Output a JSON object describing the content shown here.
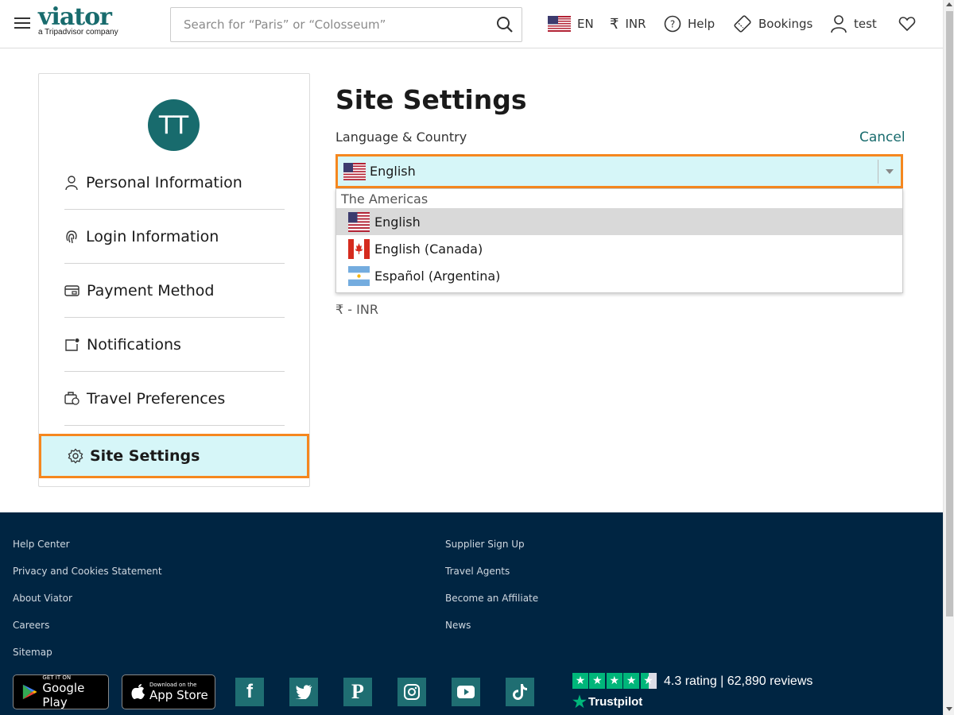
{
  "header": {
    "brand": "viator",
    "brand_sub": "a Tripadvisor company",
    "search_placeholder": "Search for “Paris” or “Colosseum”",
    "lang_label": "EN",
    "currency_label": "INR",
    "help_label": "Help",
    "bookings_label": "Bookings",
    "user_label": "test"
  },
  "sidebar": {
    "avatar_initials": "TT",
    "items": [
      {
        "label": "Personal Information",
        "icon": "person-icon"
      },
      {
        "label": "Login Information",
        "icon": "fingerprint-icon"
      },
      {
        "label": "Payment Method",
        "icon": "card-icon"
      },
      {
        "label": "Notifications",
        "icon": "notification-icon"
      },
      {
        "label": "Travel Preferences",
        "icon": "luggage-icon"
      }
    ],
    "active": {
      "label": "Site Settings",
      "icon": "gear-icon"
    }
  },
  "main": {
    "title": "Site Settings",
    "section_label": "Language & Country",
    "cancel_label": "Cancel",
    "selected_language": "English",
    "dropdown": {
      "group": "The Americas",
      "options": [
        {
          "label": "English",
          "flag": "us-flag",
          "selected": true
        },
        {
          "label": "English (Canada)",
          "flag": "canada-flag",
          "selected": false
        },
        {
          "label": "Español (Argentina)",
          "flag": "argentina-flag",
          "selected": false
        }
      ]
    },
    "currency_value": "₹ - INR"
  },
  "footer": {
    "col1": [
      "Help Center",
      "Privacy and Cookies Statement",
      "About Viator",
      "Careers",
      "Sitemap"
    ],
    "col2": [
      "Supplier Sign Up",
      "Travel Agents",
      "Become an Affiliate",
      "News"
    ],
    "google_play_small": "GET IT ON",
    "google_play_big": "Google Play",
    "app_store_small": "Download on the",
    "app_store_big": "App Store",
    "rating_text": "4.3 rating  | 62,890 reviews",
    "trustpilot": "Trustpilot"
  },
  "colors": {
    "brand": "#186b6d",
    "highlight_bg": "#d6f6f8",
    "highlight_border": "#f5871f",
    "footer_bg": "#002542",
    "trustpilot_green": "#00b67a"
  }
}
